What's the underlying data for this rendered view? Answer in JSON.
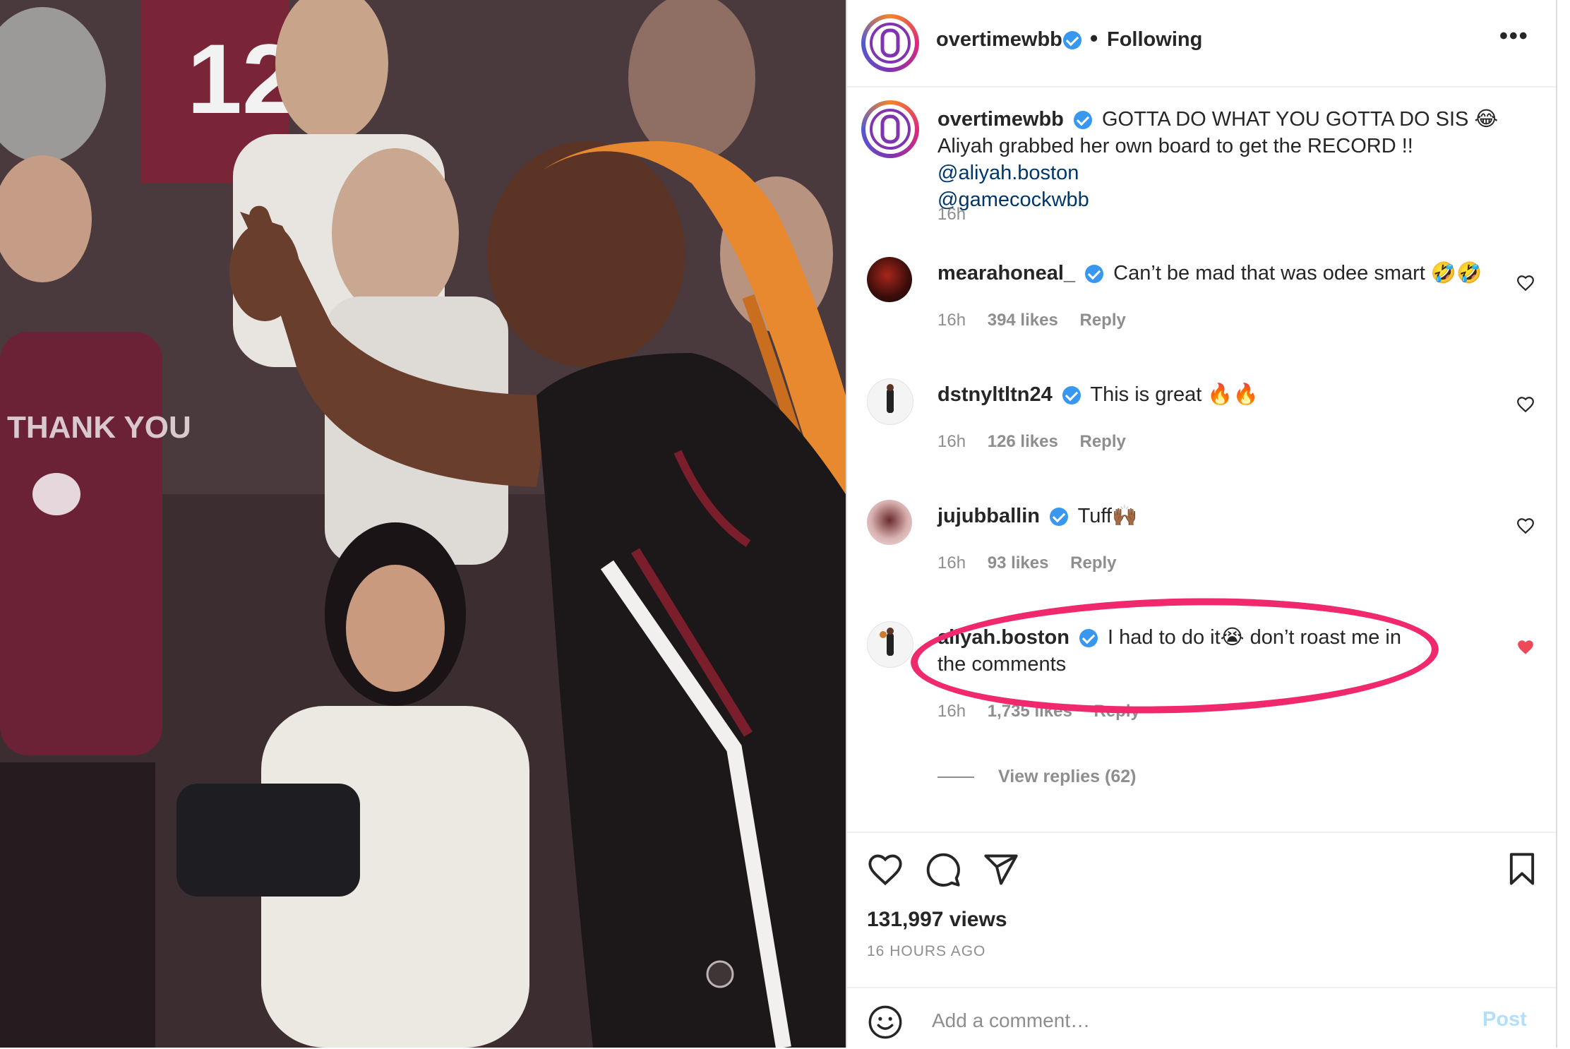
{
  "header": {
    "username": "overtimewbb",
    "separator": "•",
    "follow_status": "Following",
    "more_label": "•••",
    "avatar_icon": "overtime-o-logo-icon"
  },
  "caption": {
    "username": "overtimewbb",
    "text": "GOTTA DO WHAT YOU GOTTA DO SIS 😂 Aliyah grabbed her own board to get the RECORD !! ",
    "mention1": "@aliyah.boston",
    "mention2": "@gamecockwbb",
    "time": "16h"
  },
  "comments": [
    {
      "username": "mearahoneal_",
      "text": "Can’t be mad that was odee smart 🤣🤣",
      "time": "16h",
      "likes": "394 likes",
      "reply": "Reply",
      "liked": false
    },
    {
      "username": "dstnyltltn24",
      "text": "This is great 🔥🔥",
      "time": "16h",
      "likes": "126 likes",
      "reply": "Reply",
      "liked": false
    },
    {
      "username": "jujubballin",
      "text": "Tuff🙌🏾",
      "time": "16h",
      "likes": "93 likes",
      "reply": "Reply",
      "liked": false
    },
    {
      "username": "aliyah.boston",
      "text": "I had to do it😭 don’t roast me in the comments",
      "time": "16h",
      "likes": "1,735 likes",
      "reply": "Reply",
      "liked": true
    }
  ],
  "view_replies": "View replies (62)",
  "actions": {
    "like_icon": "heart-outline-icon",
    "comment_icon": "comment-bubble-icon",
    "share_icon": "paper-plane-icon",
    "save_icon": "bookmark-icon"
  },
  "stats": {
    "views": "131,997 views",
    "time_ago": "16 HOURS AGO"
  },
  "add_comment": {
    "placeholder": "Add a comment…",
    "post_label": "Post",
    "emoji_icon": "smiley-face-icon"
  },
  "colors": {
    "verified": "#3897f0",
    "liked_heart": "#ed4956",
    "highlight": "#f0286e",
    "mention": "#00376b",
    "post_disabled": "#b2dffc"
  }
}
